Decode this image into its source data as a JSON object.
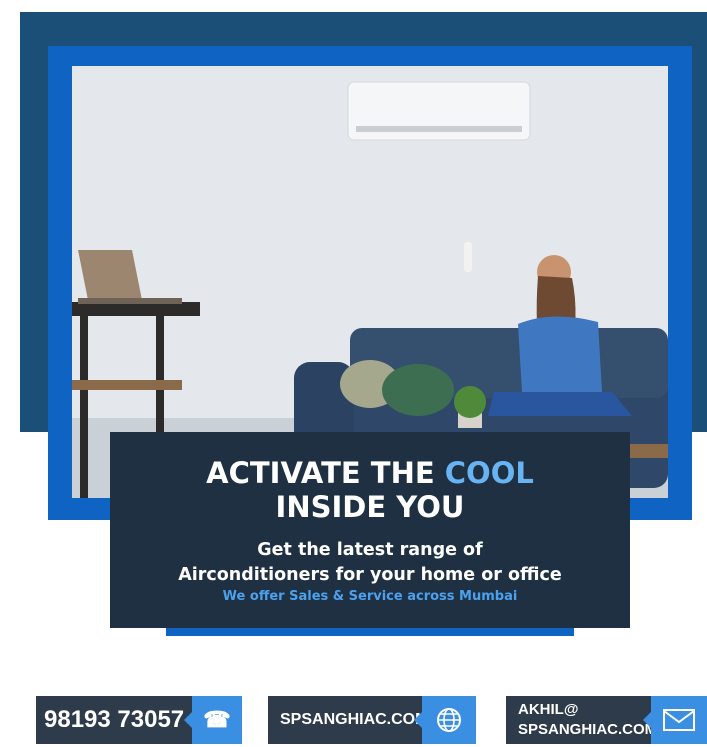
{
  "headline": {
    "line1_prefix": "ACTIVATE THE ",
    "line1_accent": "COOL",
    "line2": "INSIDE YOU"
  },
  "subheadline": {
    "line1": "Get the latest range of",
    "line2": "Airconditioners for your home or office"
  },
  "note": "We offer Sales & Service across Mumbai",
  "contacts": {
    "phone": {
      "text": "98193 73057",
      "icon": "phone-icon"
    },
    "website": {
      "text": "SPSANGHIAC.COM",
      "icon": "globe-icon"
    },
    "email": {
      "line1": "AKHIL@",
      "line2": "SPSANGHIAC.COM",
      "icon": "envelope-icon"
    }
  },
  "colors": {
    "navy": "#1c4f78",
    "blue": "#0f63c2",
    "card": "#1e3042",
    "accent": "#68b3f2",
    "tab": "#3b8fe3"
  }
}
